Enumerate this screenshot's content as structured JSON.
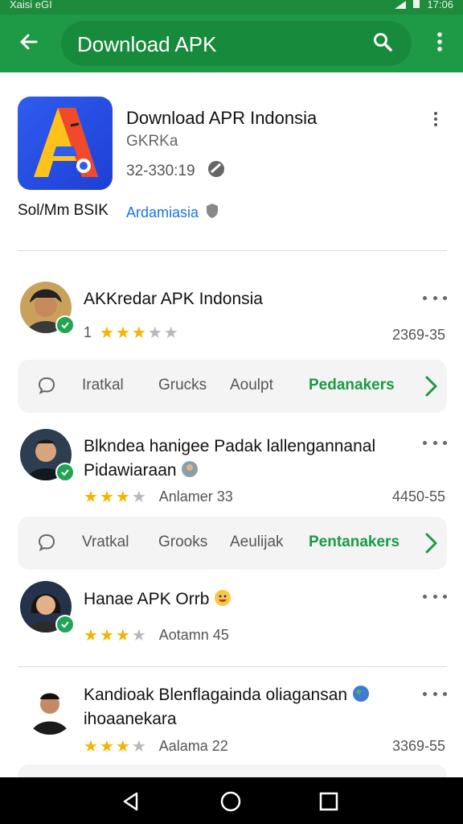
{
  "status_bar": {
    "left_text": "Xaisi eGI",
    "time": "17:06"
  },
  "app_bar": {
    "title": "Download APK"
  },
  "app": {
    "title": "Download APR Indonsia",
    "developer": "GKRKa",
    "meta": "32-330:19",
    "size": "Sol/Mm BSIK",
    "link": "Ardamiasia"
  },
  "reviews": [
    {
      "name": "AKKredar APK Indonsia",
      "rating_number": "1",
      "stars": 3,
      "date": "2369-35"
    },
    {
      "name": "Blkndea hanigee Padak lallengannanal",
      "name_line2": "Pidawiaraan",
      "stars": 3,
      "text": "Anlamer 33",
      "date": "4450-55"
    },
    {
      "name": "Hanae APK Orrb",
      "stars": 3,
      "text": "Aotamn 45"
    },
    {
      "name": "Kandioak Blenflagainda oliagansan",
      "name_line2": "ihoaanekara",
      "stars": 3,
      "text": "Aalama 22",
      "date": "3369-55"
    }
  ],
  "action_rows": [
    {
      "items": [
        "Iratkal",
        "Grucks",
        "Aoulpt"
      ],
      "primary": "Pedanakers"
    },
    {
      "items": [
        "Vratkal",
        "Grooks",
        "Aeulijak"
      ],
      "primary": "Pentanakers"
    }
  ],
  "colors": {
    "primary_green": "#1e9a46",
    "star": "#f5b400",
    "link": "#1a73e8"
  },
  "icons": [
    "back-arrow-icon",
    "search-icon",
    "more-vert-icon",
    "chat-bubble-icon",
    "chevron-right-icon",
    "verified-badge-icon",
    "nav-back-icon",
    "nav-home-icon",
    "nav-recents-icon"
  ]
}
